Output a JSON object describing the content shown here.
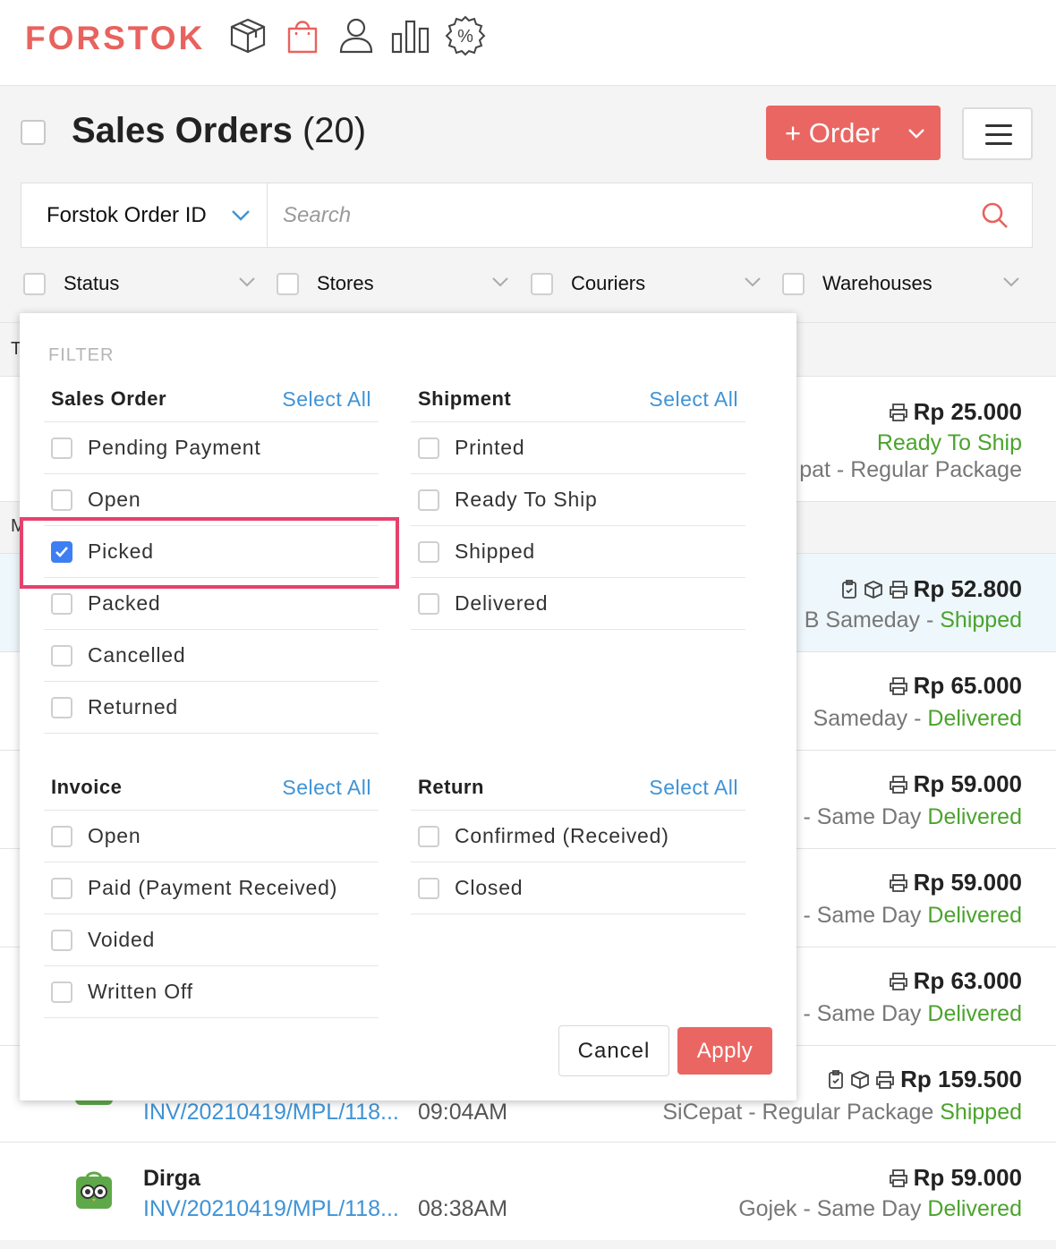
{
  "app": {
    "logo": "FORSTOK"
  },
  "nav": [
    "package-icon",
    "bag-icon",
    "user-icon",
    "bar-chart-icon",
    "discount-icon"
  ],
  "header": {
    "title": "Sales Orders",
    "count": "(20)",
    "order_button": "+ Order"
  },
  "search": {
    "field": "Forstok Order ID",
    "placeholder": "Search"
  },
  "filters": {
    "status": "Status",
    "stores": "Stores",
    "couriers": "Couriers",
    "warehouses": "Warehouses"
  },
  "popover": {
    "title": "FILTER",
    "sales_order": {
      "title": "Sales Order",
      "select_all": "Select All",
      "options": [
        "Pending Payment",
        "Open",
        "Picked",
        "Packed",
        "Cancelled",
        "Returned"
      ],
      "checked": "Picked"
    },
    "shipment": {
      "title": "Shipment",
      "select_all": "Select All",
      "options": [
        "Printed",
        "Ready To Ship",
        "Shipped",
        "Delivered"
      ]
    },
    "invoice": {
      "title": "Invoice",
      "select_all": "Select All",
      "options": [
        "Open",
        "Paid (Payment Received)",
        "Voided",
        "Written Off"
      ]
    },
    "return": {
      "title": "Return",
      "select_all": "Select All",
      "options": [
        "Confirmed (Received)",
        "Closed"
      ]
    },
    "cancel": "Cancel",
    "apply": "Apply"
  },
  "list": {
    "sections": [
      "T",
      "M"
    ],
    "orders": [
      {
        "price": "Rp 25.000",
        "status": "Ready To Ship",
        "courier": "pat - Regular Package"
      },
      {
        "price": "Rp 52.800",
        "courier": "B Sameday - ",
        "status": "Shipped"
      },
      {
        "price": "Rp 65.000",
        "courier": "Sameday - ",
        "status": "Delivered"
      },
      {
        "price": "Rp 59.000",
        "courier": "- Same Day ",
        "status": "Delivered"
      },
      {
        "price": "Rp 59.000",
        "courier": "- Same Day ",
        "status": "Delivered"
      },
      {
        "price": "Rp 63.000",
        "courier": "- Same Day ",
        "status": "Delivered"
      },
      {
        "price": "Rp 159.500",
        "invoice": "INV/20210419/MPL/118...",
        "time": "09:04AM",
        "courier": "SiCepat - Regular Package ",
        "status": "Shipped"
      },
      {
        "customer": "Dirga",
        "price": "Rp 59.000",
        "invoice": "INV/20210419/MPL/118...",
        "time": "08:38AM",
        "courier": "Gojek - Same Day ",
        "status": "Delivered"
      }
    ]
  },
  "colors": {
    "brand": "#e8625e",
    "link": "#3f93d6",
    "success": "#4ba32d",
    "highlight": "#e5416d",
    "checkbox": "#3d7ff2"
  }
}
